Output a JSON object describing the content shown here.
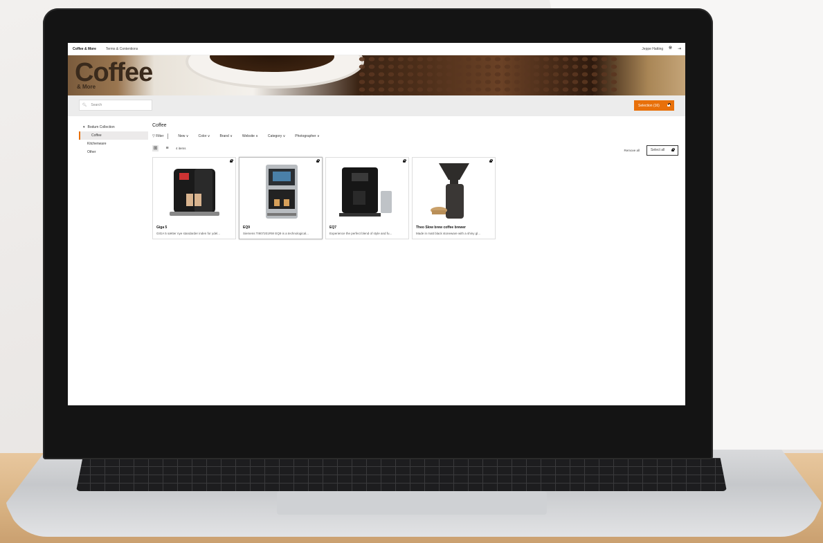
{
  "topbar": {
    "tabs": [
      "Coffee & More",
      "Terms & Contentions"
    ],
    "user_name": "Jeppe Hatting"
  },
  "hero": {
    "logo_main": "Coffee",
    "logo_sub": "& More"
  },
  "search": {
    "placeholder": "Search"
  },
  "selection_button": {
    "label": "Selection (16)"
  },
  "sidebar": {
    "root": "Bodum Collection",
    "items": [
      "Coffee",
      "Kitchenware",
      "Other"
    ],
    "selected": "Coffee"
  },
  "main": {
    "title": "Coffee",
    "filter_label": "Filter",
    "filters": [
      "New",
      "Color",
      "Brand",
      "Website",
      "Category",
      "Photographer"
    ],
    "item_count": "4 items",
    "remove_all": "Remove all",
    "select_all": "Select all"
  },
  "products": [
    {
      "name": "Giga 5",
      "desc": "GIGA 5 sætter nye standarder inden for ydel..."
    },
    {
      "name": "EQ9",
      "desc": "Siemens TI907201RW EQ9 is a technological..."
    },
    {
      "name": "EQ7",
      "desc": "Experience the perfect blend of style and fu..."
    },
    {
      "name": "Theo Slow brew coffee brewer",
      "desc": "Made in matt black stoneware with a shiny gl..."
    }
  ],
  "colors": {
    "accent": "#e8700a"
  }
}
